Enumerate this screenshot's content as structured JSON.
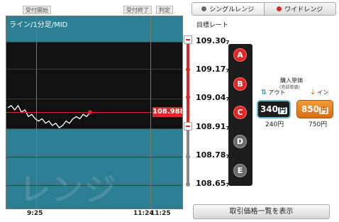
{
  "chart": {
    "header": {
      "accept_start": "受付開始",
      "accept_end": "受付終了",
      "judge": "判定"
    },
    "title": "ライン/1分足/MID",
    "watermark": "レンジ",
    "current_price": "108.988",
    "x_ticks": [
      "9:25",
      "11:24",
      "11:25"
    ],
    "colors": {
      "band": "#2c7e93",
      "price_line": "#d42a2a",
      "background": "#111111"
    }
  },
  "chart_data": {
    "type": "line",
    "title": "ライン/1分足/MID",
    "series": [
      {
        "values": [
          109.01,
          109.02,
          109.0,
          109.02,
          108.99,
          109.0,
          108.97,
          108.98,
          108.96,
          108.95,
          108.96,
          108.94,
          108.95,
          108.93,
          108.94,
          108.92,
          108.93,
          108.95,
          108.94,
          108.96,
          108.97,
          108.96,
          108.98,
          108.97,
          108.99
        ]
      }
    ],
    "range_levels": [
      109.307,
      109.177,
      109.047,
      108.917,
      108.787,
      108.657
    ]
  },
  "selector": {
    "single_range": "シングルレンジ",
    "wide_range": "ワイドレンジ"
  },
  "target_rate_label": "目標レート",
  "levels": [
    {
      "main": "109.30",
      "sub": "7"
    },
    {
      "main": "109.17",
      "sub": "7"
    },
    {
      "main": "109.04",
      "sub": "7"
    },
    {
      "main": "108.91",
      "sub": "7"
    },
    {
      "main": "108.78",
      "sub": "7"
    },
    {
      "main": "108.65",
      "sub": "7"
    }
  ],
  "options": [
    "A",
    "B",
    "C",
    "D",
    "E"
  ],
  "purchase": {
    "title": "購入単価",
    "subtitle": "(売却単価)",
    "out_label": "アウト",
    "in_label": "イン",
    "out_price": "340",
    "in_price": "850",
    "yen": "円",
    "out_payout": "240円",
    "in_payout": "750円"
  },
  "list_button": "取引価格一覧を表示"
}
